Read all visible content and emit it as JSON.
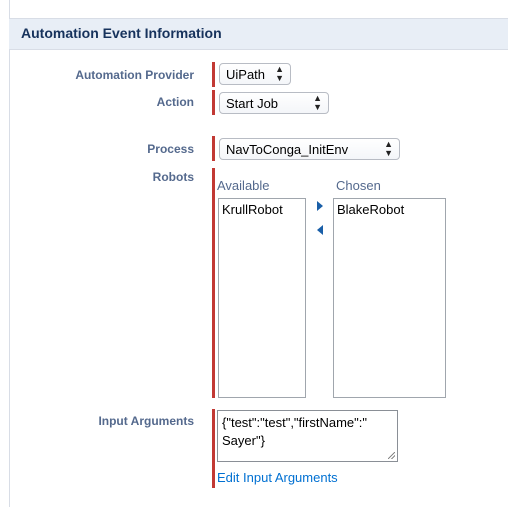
{
  "section": {
    "title": "Automation Event Information"
  },
  "fields": {
    "provider": {
      "label": "Automation Provider",
      "value": "UiPath"
    },
    "action": {
      "label": "Action",
      "value": "Start Job"
    },
    "process": {
      "label": "Process",
      "value": "NavToConga_InitEnv"
    },
    "robots": {
      "label": "Robots",
      "available_header": "Available",
      "chosen_header": "Chosen",
      "available": [
        "KrullRobot"
      ],
      "chosen": [
        "BlakeRobot"
      ]
    },
    "input_arguments": {
      "label": "Input Arguments",
      "value_line1": "{\"test\":\"test\",\"firstName\":\"",
      "value_line2": "Sayer\"}",
      "edit_link": "Edit Input Arguments"
    }
  },
  "colors": {
    "required": "#c23934",
    "link": "#0070d2",
    "header_bg": "#e8eef6"
  }
}
